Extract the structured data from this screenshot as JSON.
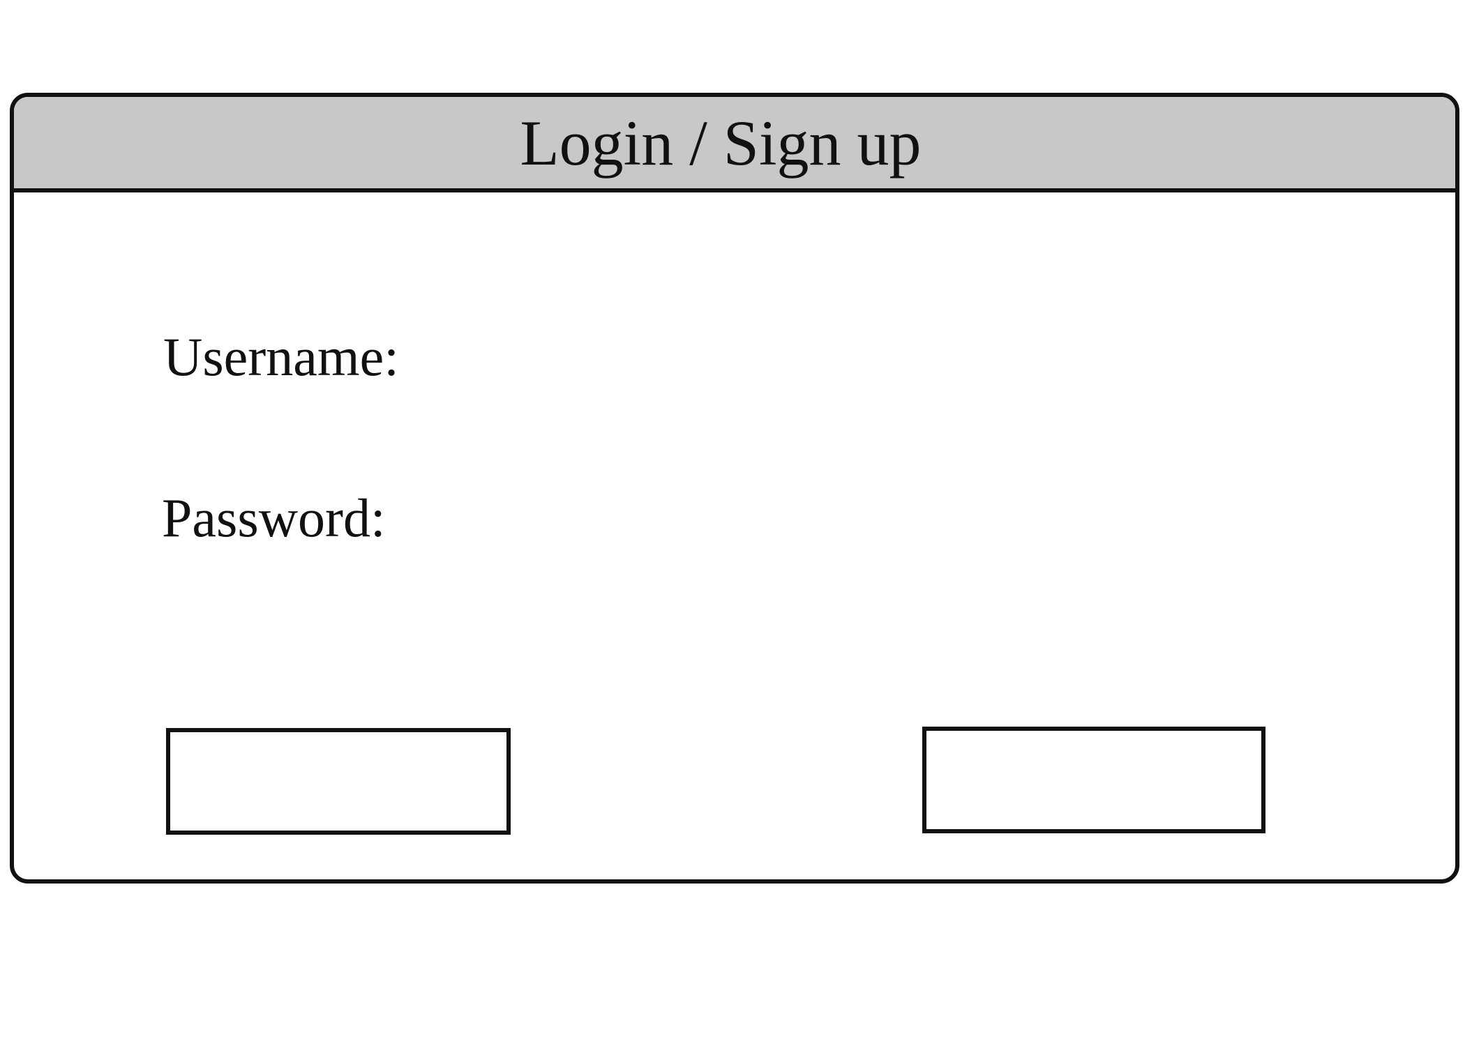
{
  "window": {
    "title": "Login / Sign up"
  },
  "form": {
    "username_label": "Username:",
    "password_label": "Password:"
  },
  "buttons": {
    "left_label": "",
    "right_label": ""
  },
  "colors": {
    "title_bar": "#c8c8c8",
    "border": "#111111",
    "background": "#ffffff"
  }
}
